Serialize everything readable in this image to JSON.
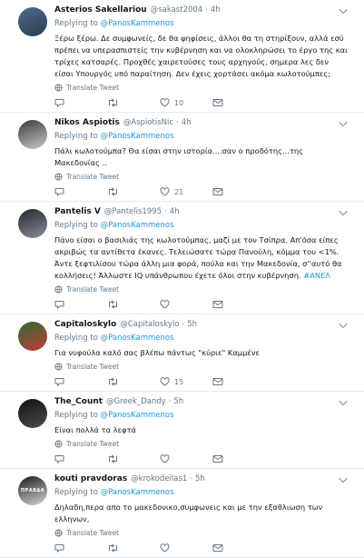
{
  "replying_label": "Replying to",
  "translate_label": "Translate Tweet",
  "tweets": [
    {
      "name": "Asterios Sakellariou",
      "handle": "@sakast2004",
      "time": "4h",
      "mention": "@PanosKammenos",
      "text": "Ξέρω ξέρω. Δε συμφωνείς, δε θα ψηφίσεις, άλλοι θα τη στηρίξουν, αλλά εσύ πρέπει να υπερασπιστείς την κυβέρνηση και να ολοκληρώσει το έργο της και τρίχες κατσαρές. Προχθές χαιρετούσες τους αρχηγούς, σημερα λες δεν είσαι Υπουργός υπό παραίτηση. Δεν έχεις χορτάσει ακόμα κωλοτούμπες;",
      "hashtag": "",
      "replies": "",
      "retweets": "",
      "likes": "10",
      "avatar_colors": [
        "#4a6a8c",
        "#2e3d4f"
      ]
    },
    {
      "name": "Nikos Aspiotis",
      "handle": "@AspiotisNic",
      "time": "4h",
      "mention": "@PanosKammenos",
      "text": "Πάλι κωλοτούμπα? Θα είσαι στην ιστορία....σαν ο προδότης...της Μακεδονίας ..",
      "hashtag": "",
      "replies": "",
      "retweets": "",
      "likes": "21",
      "avatar_colors": [
        "#3a3a3a",
        "#c9c9c9"
      ]
    },
    {
      "name": "Pantelis V",
      "handle": "@Pantelis1995",
      "time": "4h",
      "mention": "@PanosKammenos",
      "text": "Πάνο είσαι ο βασιλιάς της κωλοτούμπας, μαζί με τον Τσίπρα. Απ'όσα είπες ακριβώς τα αντίθετα έκανες. Τελειώσατε τώρα Πανούλη, κόμμα του <1%. Άντε ξεφτιλίσου τώρα άλλη μια φορά, πούλα και την Μακεδονία, σ''αυτό θα κολλήσεις! Άλλωστε IQ υπάνθρωπου έχετε όλοι στην κυβέρνηση.",
      "hashtag": "#ΑΝΕΛ",
      "replies": "",
      "retweets": "",
      "likes": "",
      "avatar_colors": [
        "#222831",
        "#8a8f96"
      ]
    },
    {
      "name": "Capitaloskylo",
      "handle": "@Capitaloskylo",
      "time": "5h",
      "mention": "@PanosKammenos",
      "text": "Για νυφούλα καλό σας βλέπω πάντως \"κύριε\" Καμμένε",
      "hashtag": "",
      "replies": "",
      "retweets": "",
      "likes": "15",
      "avatar_colors": [
        "#2f6b2f",
        "#c23b3b"
      ]
    },
    {
      "name": "The_Count",
      "handle": "@Greek_Dandy",
      "time": "5h",
      "mention": "@PanosKammenos",
      "text": "Είναι πολλά τα λεφτά",
      "hashtag": "",
      "replies": "",
      "retweets": "",
      "likes": "",
      "avatar_colors": [
        "#111111",
        "#4d4d4d"
      ]
    },
    {
      "name": "kouti pravdoras",
      "handle": "@krokodeilas1",
      "time": "5h",
      "mention": "@PanosKammenos",
      "text": "Δηλαδη,περα απο το μακεδονικο,συμφωνεις και με την εξαθλιωση των ελληνων,",
      "hashtag": "",
      "replies": "",
      "retweets": "",
      "likes": "",
      "avatar_colors": [
        "#1a1a1a",
        "#d8d8d8"
      ],
      "avatar_text": "ΠΡΑΒΔΑ"
    }
  ]
}
